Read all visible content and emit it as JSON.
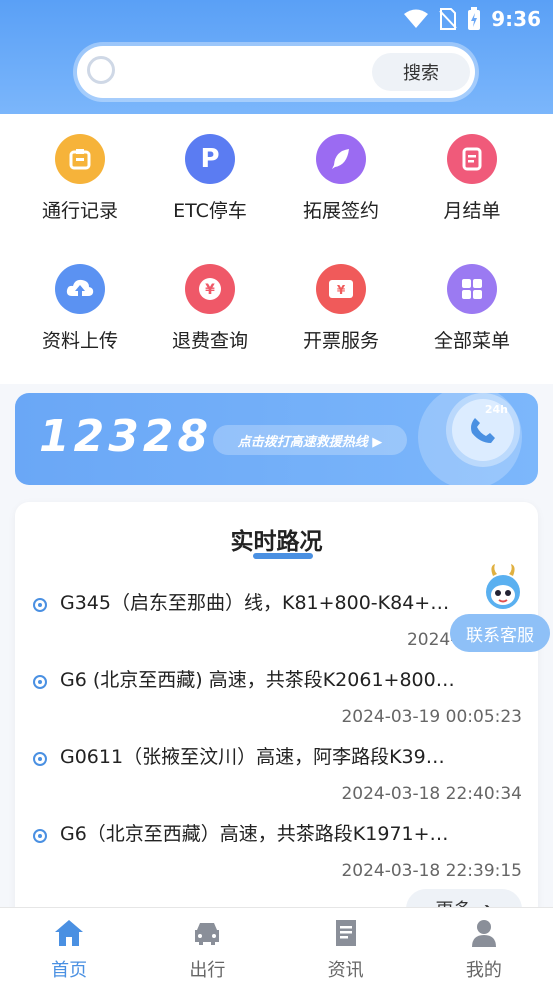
{
  "status_bar": {
    "time": "9:36"
  },
  "search": {
    "placeholder": "",
    "button_label": "搜索"
  },
  "grid": [
    {
      "label": "通行记录",
      "icon": "record-icon",
      "color": "#f6b33a"
    },
    {
      "label": "ETC停车",
      "icon": "parking-icon",
      "color": "#5b7cf2"
    },
    {
      "label": "拓展签约",
      "icon": "feather-icon",
      "color": "#9b6bf2"
    },
    {
      "label": "月结单",
      "icon": "statement-icon",
      "color": "#f05a7a"
    },
    {
      "label": "资料上传",
      "icon": "cloud-upload-icon",
      "color": "#5b92f2"
    },
    {
      "label": "退费查询",
      "icon": "refund-icon",
      "color": "#ef5868"
    },
    {
      "label": "开票服务",
      "icon": "invoice-icon",
      "color": "#f05a5a"
    },
    {
      "label": "全部菜单",
      "icon": "menu-grid-icon",
      "color": "#9b7af2"
    }
  ],
  "hotline": {
    "number": "12328",
    "tagline": "点击拨打高速救援热线 ▶",
    "badge": "24h"
  },
  "road_status": {
    "title": "实时路况",
    "items": [
      {
        "text": "G345（启东至那曲）线，K81+800-K84+…",
        "time": "2024-03-19 0"
      },
      {
        "text": "G6 (北京至西藏) 高速，共茶段K2061+800…",
        "time": "2024-03-19 00:05:23"
      },
      {
        "text": "G0611（张掖至汶川）高速，阿李路段K39…",
        "time": "2024-03-18 22:40:34"
      },
      {
        "text": "G6（北京至西藏）高速，共茶路段K1971+…",
        "time": "2024-03-18 22:39:15"
      }
    ],
    "more_label": "更多"
  },
  "customer_service": {
    "label": "联系客服"
  },
  "tabs": [
    {
      "label": "首页",
      "icon": "home-icon",
      "active": true
    },
    {
      "label": "出行",
      "icon": "car-icon",
      "active": false
    },
    {
      "label": "资讯",
      "icon": "news-icon",
      "active": false
    },
    {
      "label": "我的",
      "icon": "user-icon",
      "active": false
    }
  ]
}
